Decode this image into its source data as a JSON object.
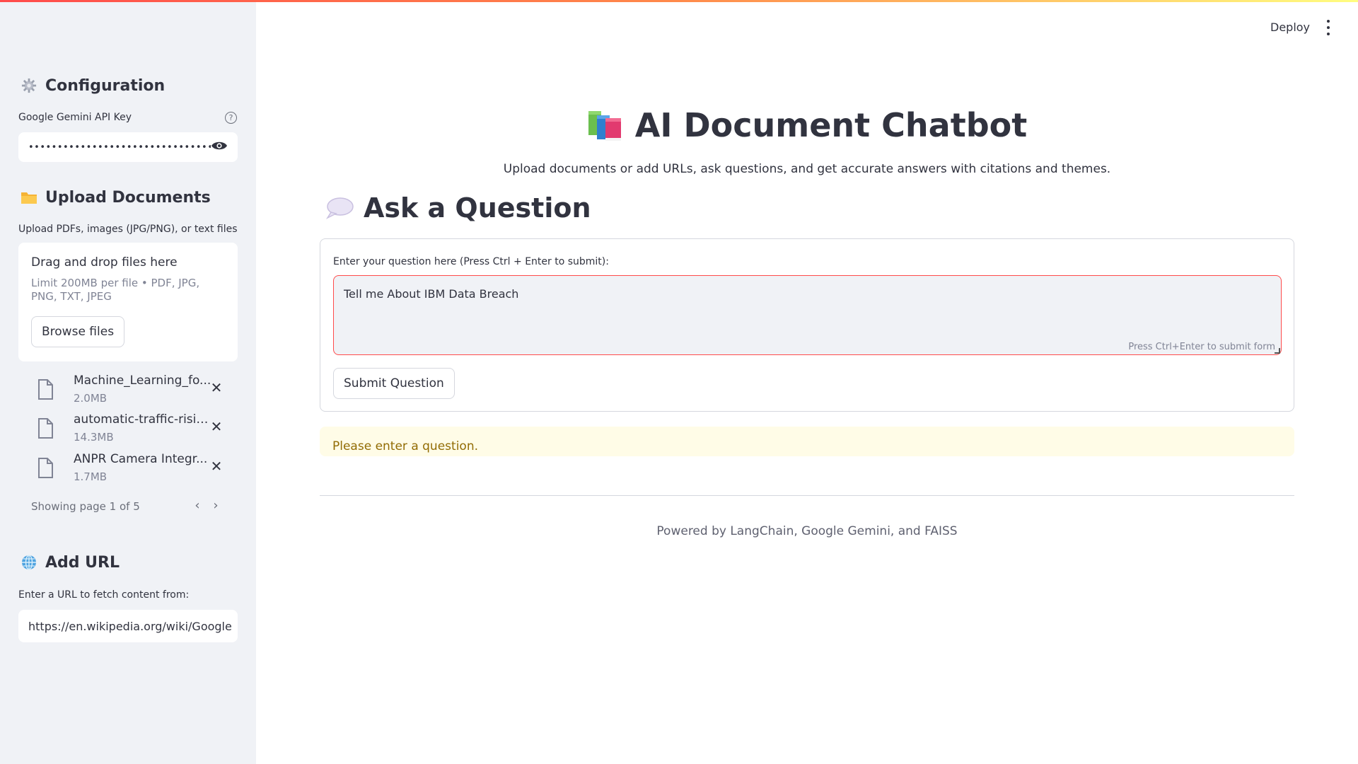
{
  "top_bar": {
    "deploy_label": "Deploy",
    "menu_icon": "more-vertical-icon"
  },
  "sidebar": {
    "configuration": {
      "title": "Configuration",
      "icon": "gear-icon",
      "api_key_label": "Google Gemini API Key",
      "api_key_masked": "••••••••••••••••••••••••••••••••••••••••",
      "help_icon": "help-circle-icon",
      "reveal_icon": "eye-icon"
    },
    "upload": {
      "title": "Upload Documents",
      "icon": "folder-icon",
      "instructions": "Upload PDFs, images (JPG/PNG), or text files",
      "dropzone_title": "Drag and drop files here",
      "dropzone_limit": "Limit 200MB per file • PDF, JPG, PNG, TXT, JPEG",
      "browse_label": "Browse files",
      "files": [
        {
          "name": "Machine_Learning_fo...",
          "size": "2.0MB"
        },
        {
          "name": "automatic-traffic-risin...",
          "size": "14.3MB"
        },
        {
          "name": "ANPR Camera Integr...",
          "size": "1.7MB"
        }
      ],
      "pagination": "Showing page 1 of 5"
    },
    "add_url": {
      "title": "Add URL",
      "icon": "globe-icon",
      "label": "Enter a URL to fetch content from:",
      "value": "https://en.wikipedia.org/wiki/Google"
    }
  },
  "main": {
    "title": "AI Document Chatbot",
    "title_icon": "books-icon",
    "subtitle": "Upload documents or add URLs, ask questions, and get accurate answers with citations and themes.",
    "ask_header": "Ask a Question",
    "ask_icon": "speech-bubble-icon",
    "question_label": "Enter your question here (Press Ctrl + Enter to submit):",
    "question_value": "Tell me About IBM Data Breach",
    "textarea_hint": "Press Ctrl+Enter to submit form",
    "submit_label": "Submit Question",
    "warning": "Please enter a question.",
    "footer": "Powered by LangChain, Google Gemini, and FAISS"
  },
  "colors": {
    "accent": "#ff4b4b",
    "sidebar_bg": "#f0f2f6",
    "warning_bg": "#fffce7",
    "warning_text": "#926c05"
  }
}
